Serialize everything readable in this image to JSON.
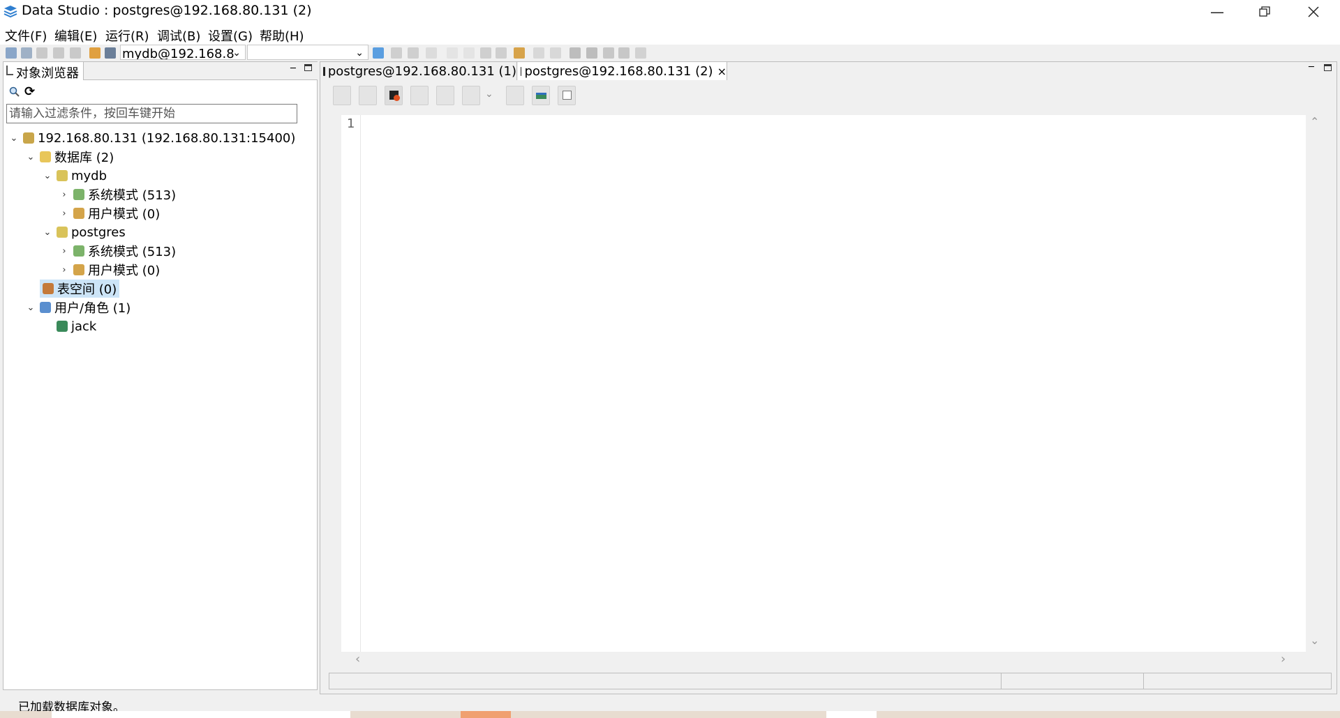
{
  "window": {
    "title": "Data Studio : postgres@192.168.80.131 (2)",
    "minimize_icon": "minimize-icon",
    "restore_icon": "restore-icon",
    "close_icon": "close-icon"
  },
  "menu": [
    "文件(F)",
    "编辑(E)",
    "运行(R)",
    "调试(B)",
    "设置(G)",
    "帮助(H)"
  ],
  "toolbar": {
    "connection_value": "mydb@192.168.8",
    "accent": "#3a7bd5"
  },
  "object_browser": {
    "tab_label": "对象浏览器",
    "filter_placeholder": "请输入过滤条件，按回车键开始",
    "tree": {
      "server": "192.168.80.131 (192.168.80.131:15400)",
      "databases": "数据库 (2)",
      "db1": "mydb",
      "db1_sys": "系统模式 (513)",
      "db1_user": "用户模式 (0)",
      "db2": "postgres",
      "db2_sys": "系统模式 (513)",
      "db2_user": "用户模式 (0)",
      "tablespaces": "表空间 (0)",
      "users_roles": "用户/角色 (1)",
      "user1": "jack"
    }
  },
  "editor": {
    "tab1": "postgres@192.168.80.131 (1)",
    "tab2": "postgres@192.168.80.131 (2)",
    "line_number": "1"
  },
  "statusbar": {
    "message": "已加载数据库对象。"
  }
}
